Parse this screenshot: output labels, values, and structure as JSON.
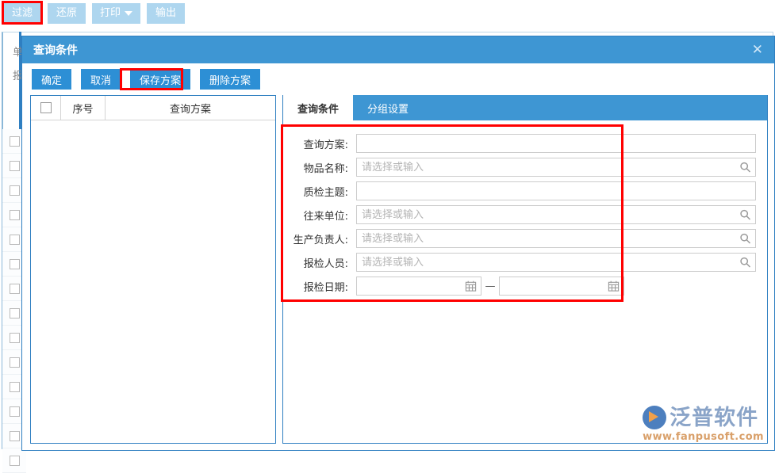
{
  "toolbar": {
    "buttons": [
      {
        "label": "过滤",
        "name": "filter-button",
        "highlighted": true
      },
      {
        "label": "还原",
        "name": "restore-button"
      },
      {
        "label": "打印",
        "name": "print-button",
        "has_caret": true
      },
      {
        "label": "输出",
        "name": "export-button"
      }
    ]
  },
  "background": {
    "label_top": "单",
    "label_bottom": "报",
    "row_count": 14
  },
  "dialog": {
    "title": "查询条件",
    "close_icon": "✕",
    "actions": [
      {
        "label": "确定",
        "name": "confirm-button"
      },
      {
        "label": "取消",
        "name": "cancel-button"
      },
      {
        "label": "保存方案",
        "name": "save-scheme-button",
        "highlighted": true
      },
      {
        "label": "删除方案",
        "name": "delete-scheme-button"
      }
    ],
    "scheme_table": {
      "columns": [
        "",
        "序号",
        "查询方案"
      ],
      "rows": []
    },
    "tabs": [
      {
        "label": "查询条件",
        "active": true
      },
      {
        "label": "分组设置",
        "active": false
      }
    ],
    "form": {
      "fields": [
        {
          "label": "查询方案:",
          "value": "",
          "placeholder": "",
          "icon": "none"
        },
        {
          "label": "物品名称:",
          "value": "",
          "placeholder": "请选择或输入",
          "icon": "search-icon"
        },
        {
          "label": "质检主题:",
          "value": "",
          "placeholder": "",
          "icon": "none"
        },
        {
          "label": "往来单位:",
          "value": "",
          "placeholder": "请选择或输入",
          "icon": "search-icon"
        },
        {
          "label": "生产负责人:",
          "value": "",
          "placeholder": "请选择或输入",
          "icon": "search-icon"
        },
        {
          "label": "报检人员:",
          "value": "",
          "placeholder": "请选择或输入",
          "icon": "search-icon"
        }
      ],
      "date_field": {
        "label": "报检日期:",
        "start_value": "",
        "end_value": "",
        "separator": "—",
        "icon": "calendar-icon"
      }
    }
  },
  "watermark": {
    "name": "泛普软件",
    "url": "www.fanpusoft.com"
  },
  "colors": {
    "dialog_header": "#3e96d3",
    "button_blue": "#2d8fd5",
    "toolbar_blue": "#aed6ef",
    "highlight_red": "#ff0000",
    "border_blue": "#2f7fc1"
  }
}
